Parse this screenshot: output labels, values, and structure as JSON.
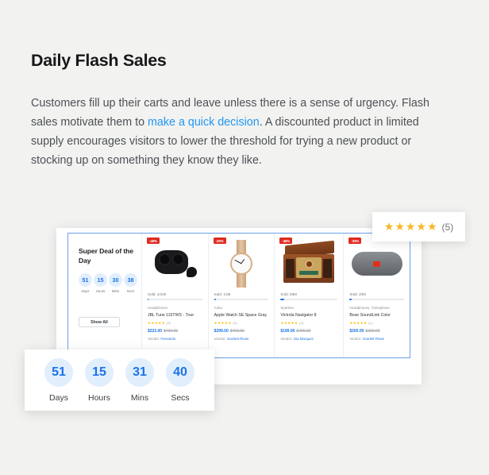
{
  "section": {
    "heading": "Daily Flash Sales",
    "paragraph_part1": "Customers fill up their carts and leave unless there is a sense of urgency. Flash sales motivate them to ",
    "link_text": "make a quick decision",
    "paragraph_part2": ". A discounted product in limited supply encourages visitors to lower the threshold for trying a new product or stocking up on something they know they like.",
    "link_color": "#2196f3",
    "heading_color": "#16181a"
  },
  "review_badge": {
    "stars": "★★★★★",
    "count": "(5)",
    "star_color": "#f5b825"
  },
  "countdown": {
    "units": [
      {
        "value": "51",
        "label": "Days"
      },
      {
        "value": "15",
        "label": "Hours"
      },
      {
        "value": "31",
        "label": "Mins"
      },
      {
        "value": "40",
        "label": "Secs"
      }
    ],
    "circle_bg": "#e1eefc",
    "number_color": "#1a73e8"
  },
  "deal_panel": {
    "title": "Super Deal of the Day",
    "timer": [
      {
        "value": "51",
        "label": "Days"
      },
      {
        "value": "15",
        "label": "Hours"
      },
      {
        "value": "30",
        "label": "Mins"
      },
      {
        "value": "38",
        "label": "Secs"
      }
    ],
    "show_all_label": "Show All",
    "border_color": "#6c9fe8"
  },
  "products": [
    {
      "badge": "-45%",
      "sold": "Sold: 1/100",
      "progress": 1,
      "brand": "Headphones",
      "name": "JBL Tune 115TWS - True",
      "stars": "★★★★★",
      "reviews": "(3)",
      "price": "$222.00",
      "old_price": "$400.00",
      "vendor_label": "Vendor: ",
      "vendor": "Fernando",
      "image": "earbuds-image"
    },
    {
      "badge": "-25%",
      "sold": "Sold: 1/35",
      "progress": 3,
      "brand": "Anbu",
      "name": "Apple Watch SE Space Gray",
      "stars": "★★★★★",
      "reviews": "(3)",
      "price": "$299.00",
      "old_price": "$400.00",
      "vendor_label": "Vendor: ",
      "vendor": "Scarlett Rivas",
      "image": "watch-image"
    },
    {
      "badge": "-46%",
      "sold": "Sold: 5/80",
      "progress": 6,
      "brand": "Sparkea",
      "name": "Victrola Navigator 8",
      "stars": "★★★★★",
      "reviews": "(2)",
      "price": "$199.00",
      "old_price": "$400.00",
      "vendor_label": "Vendor: ",
      "vendor": "Gia Marquez",
      "image": "record-player-image"
    },
    {
      "badge": "-33%",
      "sold": "Sold: 2/50",
      "progress": 4,
      "brand": "Headphones, Transphoen",
      "name": "Bose SoundLink Color",
      "stars": "★★★★★",
      "reviews": "(1)",
      "price": "$200.00",
      "old_price": "$300.00",
      "vendor_label": "Vendor: ",
      "vendor": "Scarlett Rivas",
      "image": "jbl-speaker-image"
    }
  ]
}
